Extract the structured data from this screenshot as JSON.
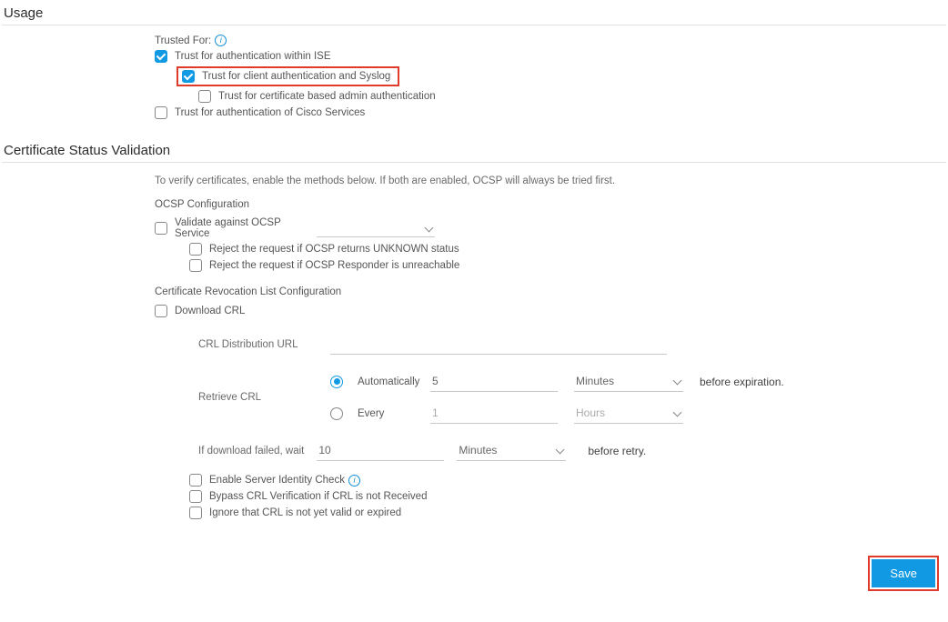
{
  "sections": {
    "usage": "Usage",
    "csv": "Certificate Status Validation"
  },
  "usage": {
    "trusted_for_label": "Trusted For:",
    "cb_ise": "Trust for authentication within ISE",
    "cb_client_syslog": "Trust for client authentication and Syslog",
    "cb_cert_admin": "Trust for certificate based admin authentication",
    "cb_cisco": "Trust for authentication of Cisco Services"
  },
  "csv": {
    "note": "To verify certificates, enable the methods below. If both are enabled, OCSP will always be tried first.",
    "ocsp_heading": "OCSP Configuration",
    "cb_validate_ocsp": "Validate against OCSP Service",
    "ocsp_service_value": "",
    "cb_reject_unknown": "Reject the request if OCSP returns UNKNOWN status",
    "cb_reject_unreach": "Reject the request if OCSP Responder is unreachable",
    "crl_heading": "Certificate Revocation List Configuration",
    "cb_download_crl": "Download CRL",
    "crl_url_label": "CRL Distribution URL",
    "crl_url_value": "",
    "retrieve_label": "Retrieve CRL",
    "radio_auto": "Automatically",
    "auto_value": "5",
    "auto_unit": "Minutes",
    "before_exp": "before expiration.",
    "radio_every": "Every",
    "every_value": "1",
    "every_unit": "Hours",
    "dl_fail_label": "If download failed, wait",
    "dl_fail_value": "10",
    "dl_fail_unit": "Minutes",
    "before_retry": "before retry.",
    "cb_server_identity": "Enable Server Identity Check",
    "cb_bypass": "Bypass CRL Verification if CRL is not Received",
    "cb_ignore": "Ignore that CRL is not yet valid or expired"
  },
  "footer": {
    "save": "Save"
  }
}
